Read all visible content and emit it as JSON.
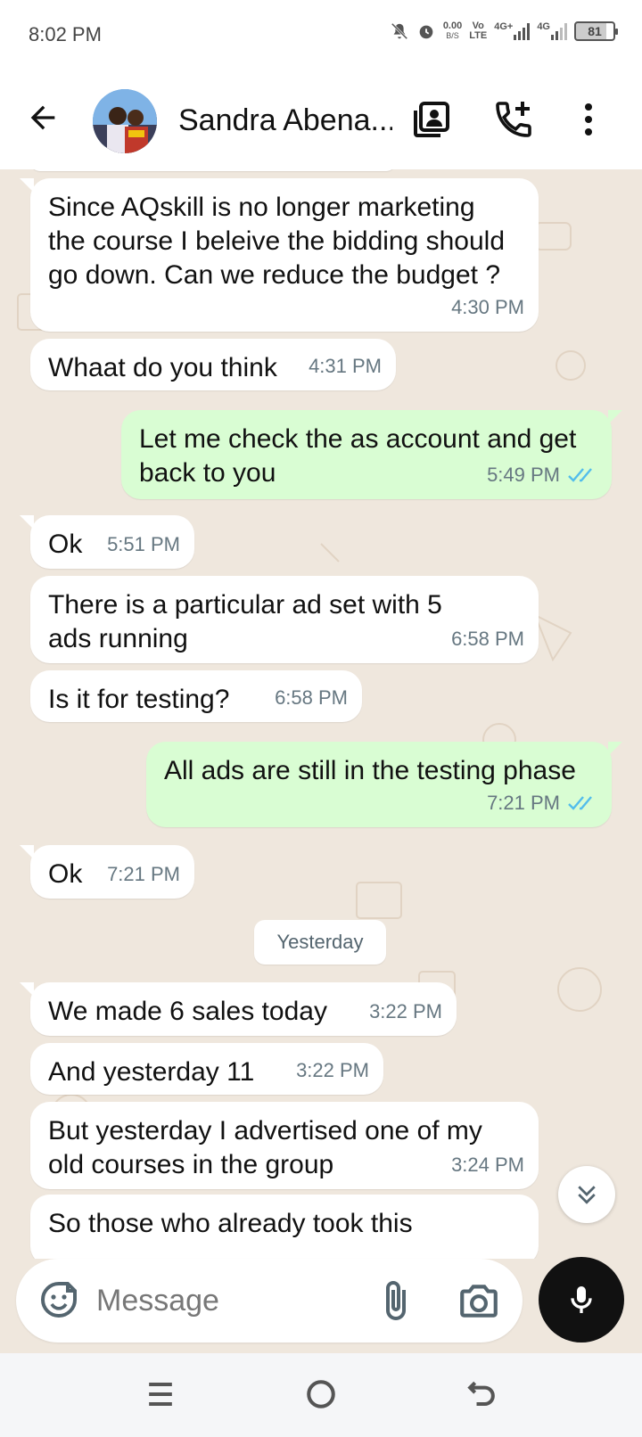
{
  "status_bar": {
    "time": "8:02 PM",
    "data_speed": "0.00",
    "data_unit": "B/S",
    "volte_top": "Vo",
    "volte_bottom": "LTE",
    "net1": "4G+",
    "net2": "4G",
    "battery": "81",
    "icons": [
      "mute-icon",
      "alarm-icon",
      "signal-icon",
      "battery-icon"
    ]
  },
  "header": {
    "contact_name": "Sandra Abena...",
    "icons": [
      "back-arrow-icon",
      "avatar",
      "contact-card-icon",
      "add-call-icon",
      "more-vert-icon"
    ]
  },
  "messages": [
    {
      "direction": "in",
      "text": "Since AQskill is no longer marketing the course I beleive the bidding should go down. Can we reduce the budget ?",
      "time": "4:30 PM"
    },
    {
      "direction": "in",
      "text": "Whaat do you think",
      "time": "4:31 PM"
    },
    {
      "direction": "out",
      "text": "Let me check the as account and get back to you",
      "time": "5:49 PM",
      "status": "read"
    },
    {
      "direction": "in",
      "text": "Ok",
      "time": "5:51 PM"
    },
    {
      "direction": "in",
      "text": "There is a particular ad set with 5 ads running",
      "time": "6:58 PM"
    },
    {
      "direction": "in",
      "text": "Is it for testing?",
      "time": "6:58 PM"
    },
    {
      "direction": "out",
      "text": "All ads are still in the testing phase",
      "time": "7:21 PM",
      "status": "read"
    },
    {
      "direction": "in",
      "text": "Ok",
      "time": "7:21 PM"
    },
    {
      "direction": "in",
      "text": "We made 6 sales today",
      "time": "3:22 PM"
    },
    {
      "direction": "in",
      "text": "And yesterday 11",
      "time": "3:22 PM"
    },
    {
      "direction": "in",
      "text": "But yesterday I advertised one of my old courses in the group",
      "time": "3:24 PM"
    },
    {
      "direction": "in",
      "text": "So those who already took this",
      "time": ""
    }
  ],
  "date_divider": "Yesterday",
  "composer": {
    "placeholder": "Message",
    "icons": [
      "emoji-sticker-icon",
      "attach-icon",
      "camera-icon",
      "mic-icon"
    ]
  },
  "colors": {
    "chat_bg": "#efe7dd",
    "incoming_bubble": "#ffffff",
    "outgoing_bubble": "#d9fdd3",
    "read_ticks": "#53bdeb",
    "timestamp": "#667781"
  },
  "navbar": {
    "icons": [
      "recents-icon",
      "home-icon",
      "back-nav-icon"
    ]
  }
}
